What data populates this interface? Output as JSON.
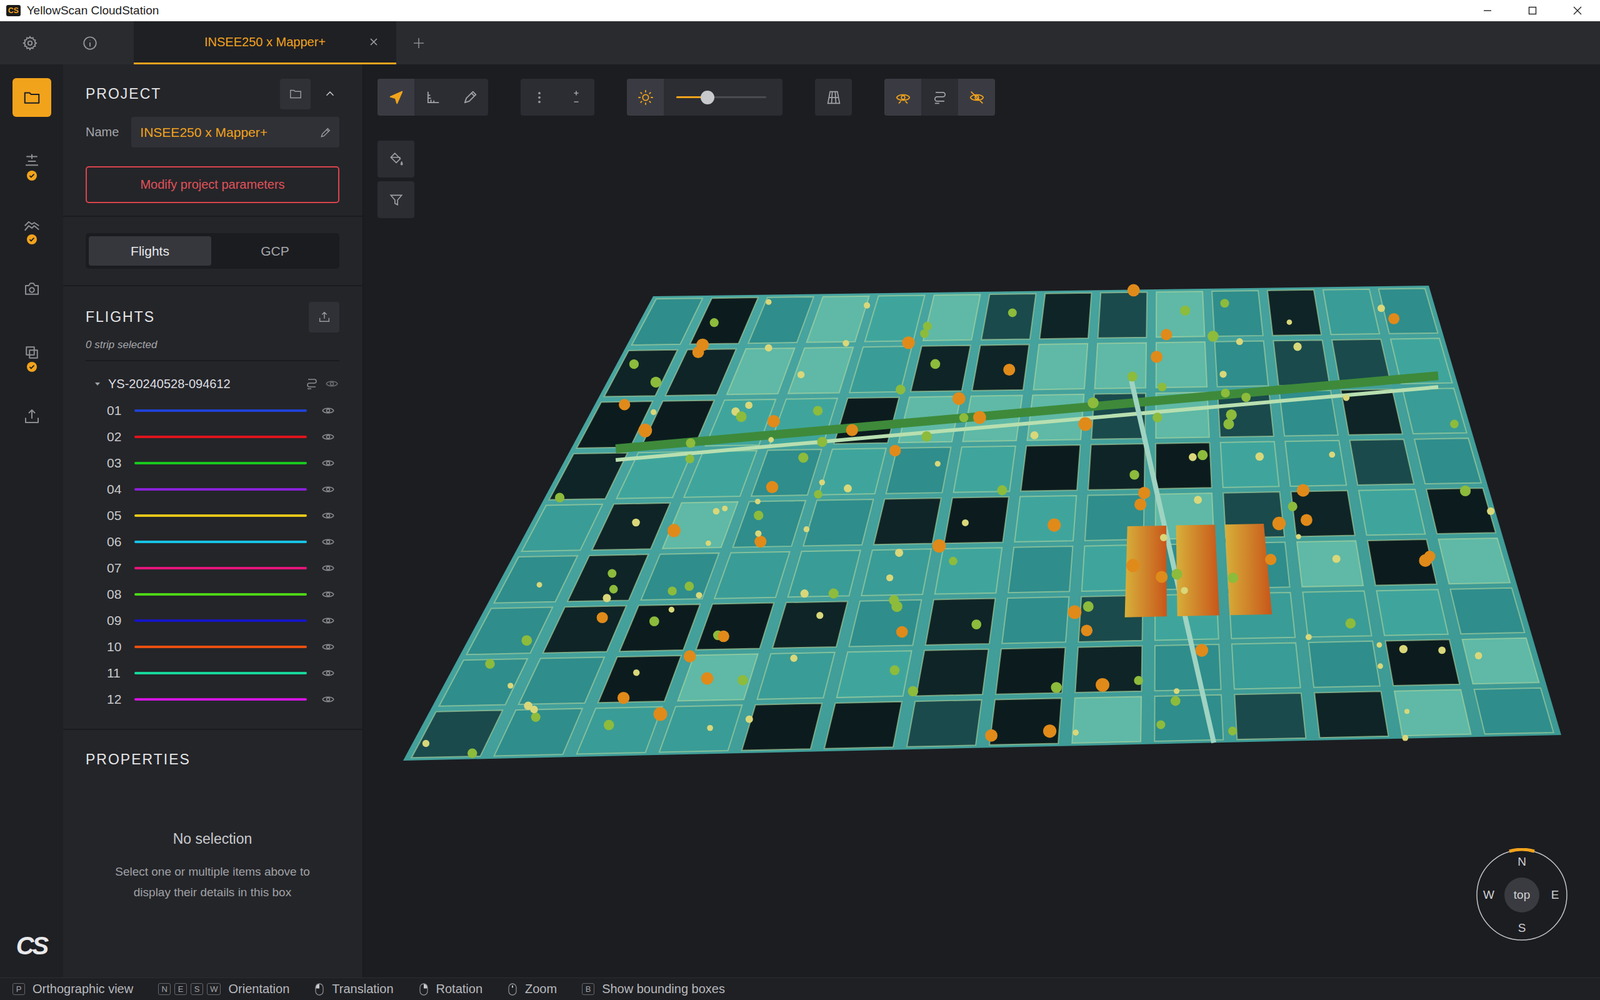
{
  "window": {
    "title": "YellowScan CloudStation",
    "app_icon": "CS"
  },
  "tabs": [
    {
      "label": "INSEE250 x Mapper+",
      "selected": true
    }
  ],
  "rail": [
    {
      "selected": true,
      "done": false
    },
    {
      "selected": false,
      "done": true
    },
    {
      "selected": false,
      "done": true
    },
    {
      "selected": false,
      "done": false
    },
    {
      "selected": false,
      "done": true
    },
    {
      "selected": false,
      "done": false
    }
  ],
  "logo": "CS",
  "project": {
    "title": "PROJECT",
    "expanded": true,
    "name_label": "Name",
    "name": "INSEE250 x Mapper+",
    "modify_button": "Modify project parameters"
  },
  "segments": [
    {
      "label": "Flights",
      "selected": true
    },
    {
      "label": "GCP",
      "selected": false
    }
  ],
  "flights": {
    "title": "FLIGHTS",
    "selection": "0 strip selected",
    "group": {
      "name": "YS-20240528-094612",
      "expanded": true
    },
    "strips": [
      {
        "label": "01",
        "color": "#1f42d8",
        "visible": true
      },
      {
        "label": "02",
        "color": "#e0141c",
        "visible": true
      },
      {
        "label": "03",
        "color": "#19c81f",
        "visible": true
      },
      {
        "label": "04",
        "color": "#8a20d8",
        "visible": true
      },
      {
        "label": "05",
        "color": "#e6c61a",
        "visible": true
      },
      {
        "label": "06",
        "color": "#17c3e3",
        "visible": true
      },
      {
        "label": "07",
        "color": "#e3167a",
        "visible": true
      },
      {
        "label": "08",
        "color": "#4cd616",
        "visible": true
      },
      {
        "label": "09",
        "color": "#1515c8",
        "visible": true
      },
      {
        "label": "10",
        "color": "#e85010",
        "visible": true
      },
      {
        "label": "11",
        "color": "#17d89a",
        "visible": true
      },
      {
        "label": "12",
        "color": "#d415e0",
        "visible": true
      }
    ]
  },
  "properties": {
    "title": "PROPERTIES",
    "empty_title": "No selection",
    "empty_text": "Select one or multiple items above to display their details in this box"
  },
  "toolbar": {
    "tools": [
      {
        "selected": true
      },
      {
        "selected": false
      },
      {
        "selected": false
      }
    ],
    "light": {
      "on": true,
      "level": 0.35
    },
    "view_tools": [
      {
        "selected": true
      },
      {
        "selected": false
      },
      {
        "selected": true
      }
    ]
  },
  "compass": {
    "center": "top",
    "n": "N",
    "e": "E",
    "s": "S",
    "w": "W"
  },
  "status_bar": [
    {
      "kind": "key",
      "keys": [
        "P"
      ],
      "label": "Orthographic view"
    },
    {
      "kind": "key",
      "keys": [
        "N",
        "E",
        "S",
        "W"
      ],
      "label": "Orientation"
    },
    {
      "kind": "mouse",
      "button": "left",
      "label": "Translation"
    },
    {
      "kind": "mouse",
      "button": "right",
      "label": "Rotation"
    },
    {
      "kind": "mouse",
      "button": "wheel",
      "label": "Zoom"
    },
    {
      "kind": "key",
      "keys": [
        "B"
      ],
      "label": "Show bounding boxes"
    }
  ]
}
